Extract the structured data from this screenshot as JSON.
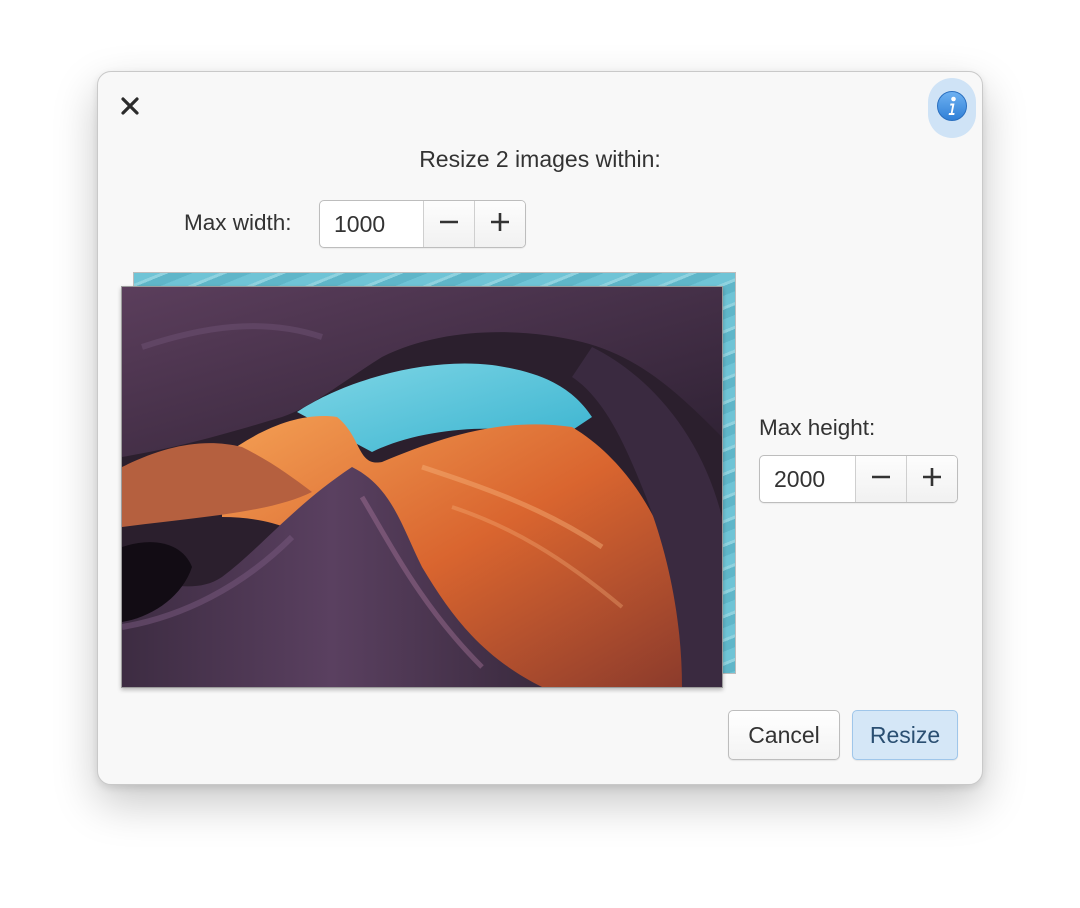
{
  "dialog": {
    "title": "Resize 2 images within:",
    "close_icon": "close-icon",
    "info_icon": "info-icon",
    "accent_color": "#3d8ee0"
  },
  "max_width": {
    "label": "Max width:",
    "value": "1000",
    "decrement_icon": "minus-icon",
    "increment_icon": "plus-icon"
  },
  "max_height": {
    "label": "Max height:",
    "value": "2000",
    "decrement_icon": "minus-icon",
    "increment_icon": "plus-icon"
  },
  "preview": {
    "image_count": 2
  },
  "actions": {
    "cancel_label": "Cancel",
    "resize_label": "Resize",
    "resize_color": "#d5e7f7"
  }
}
